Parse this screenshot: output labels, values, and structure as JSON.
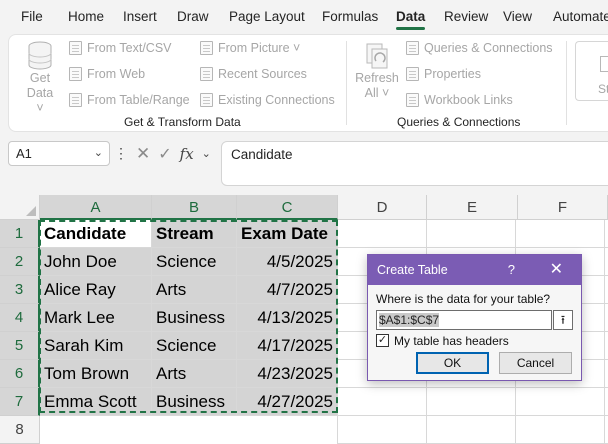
{
  "menu": {
    "tabs": [
      "File",
      "Home",
      "Insert",
      "Draw",
      "Page Layout",
      "Formulas",
      "Data",
      "Review",
      "View",
      "Automate"
    ],
    "active": "Data"
  },
  "ribbon": {
    "get_data": {
      "line1": "Get",
      "line2": "Data ˅"
    },
    "get_transform_items": [
      "From Text/CSV",
      "From Web",
      "From Table/Range"
    ],
    "get_transform_items2": [
      "From Picture ˅",
      "Recent Sources",
      "Existing Connections"
    ],
    "get_transform_label": "Get & Transform Data",
    "refresh": {
      "line1": "Refresh",
      "line2": "All ˅"
    },
    "query_items": [
      "Queries & Connections",
      "Properties",
      "Workbook Links"
    ],
    "query_label": "Queries & Connections",
    "partial_label": "St"
  },
  "formula_bar": {
    "name_box": "A1",
    "content": "Candidate"
  },
  "grid": {
    "columns": [
      "A",
      "B",
      "C",
      "D",
      "E",
      "F"
    ],
    "rows": [
      "1",
      "2",
      "3",
      "4",
      "5",
      "6",
      "7",
      "8"
    ],
    "headers": [
      "Candidate",
      "Stream",
      "Exam Date"
    ],
    "data": [
      [
        "John Doe",
        "Science",
        "4/5/2025"
      ],
      [
        "Alice Ray",
        "Arts",
        "4/7/2025"
      ],
      [
        "Mark Lee",
        "Business",
        "4/13/2025"
      ],
      [
        "Sarah Kim",
        "Science",
        "4/17/2025"
      ],
      [
        "Tom Brown",
        "Arts",
        "4/23/2025"
      ],
      [
        "Emma Scott",
        "Business",
        "4/27/2025"
      ]
    ]
  },
  "dialog": {
    "title": "Create Table",
    "help": "?",
    "close": "✕",
    "prompt": "Where is the data for your table?",
    "range": "$A$1:$C$7",
    "headers_label": "My table has headers",
    "headers_checked": true,
    "ok": "OK",
    "cancel": "Cancel"
  },
  "colors": {
    "accent": "#217346",
    "dialog_title": "#7b5cb4"
  }
}
